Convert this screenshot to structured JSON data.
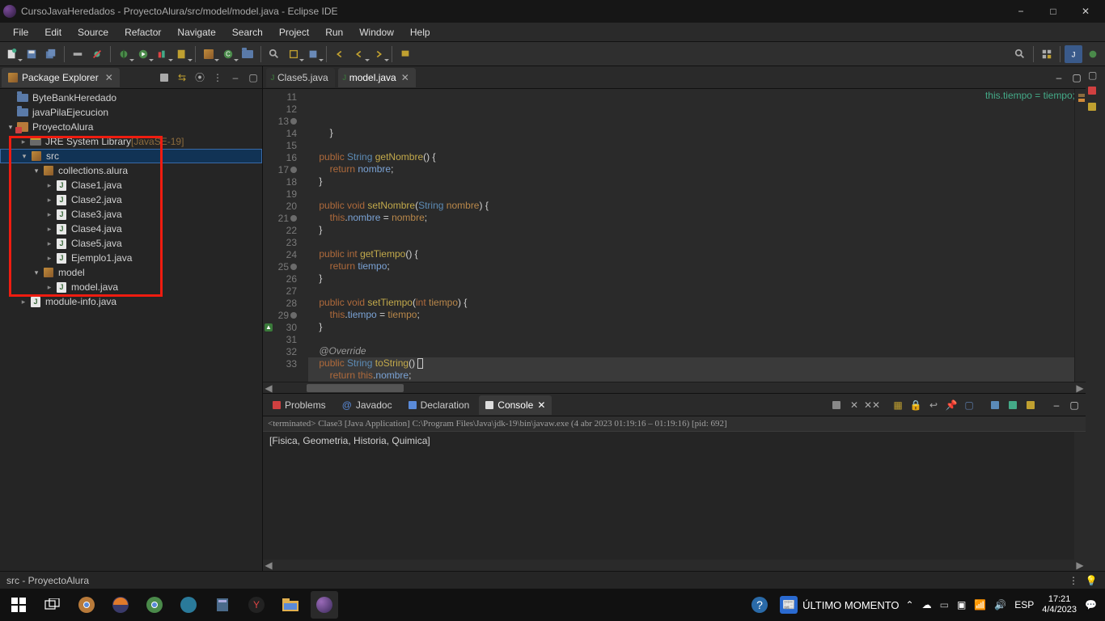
{
  "title": "CursoJavaHeredados - ProyectoAlura/src/model/model.java - Eclipse IDE",
  "menu": [
    "File",
    "Edit",
    "Source",
    "Refactor",
    "Navigate",
    "Search",
    "Project",
    "Run",
    "Window",
    "Help"
  ],
  "package_explorer": {
    "tab": "Package Explorer",
    "projects": [
      {
        "name": "ByteBankHeredado",
        "open": false,
        "icon": "folder"
      },
      {
        "name": "javaPilaEjecucion",
        "open": false,
        "icon": "folder"
      },
      {
        "name": "ProyectoAlura",
        "open": true,
        "icon": "project",
        "children": [
          {
            "name": "JRE System Library",
            "suffix": "[JavaSE-19]",
            "icon": "lib",
            "open": false
          },
          {
            "name": "src",
            "icon": "srcfolder",
            "open": true,
            "selected": true,
            "children": [
              {
                "name": "collections.alura",
                "icon": "pkg",
                "open": true,
                "children": [
                  {
                    "name": "Clase1.java",
                    "icon": "java"
                  },
                  {
                    "name": "Clase2.java",
                    "icon": "java"
                  },
                  {
                    "name": "Clase3.java",
                    "icon": "java"
                  },
                  {
                    "name": "Clase4.java",
                    "icon": "java"
                  },
                  {
                    "name": "Clase5.java",
                    "icon": "java"
                  },
                  {
                    "name": "Ejemplo1.java",
                    "icon": "java"
                  }
                ]
              },
              {
                "name": "model",
                "icon": "pkg",
                "open": true,
                "children": [
                  {
                    "name": "model.java",
                    "icon": "java"
                  }
                ]
              }
            ]
          },
          {
            "name": "module-info.java",
            "icon": "java",
            "open": false
          }
        ]
      }
    ]
  },
  "editor_tabs": [
    {
      "label": "Clase5.java",
      "active": false
    },
    {
      "label": "model.java",
      "active": true
    }
  ],
  "code_lines": [
    {
      "n": 11,
      "html": "        }"
    },
    {
      "n": 12,
      "html": ""
    },
    {
      "n": 13,
      "mark": "o",
      "html": "    <span class=\"kw\">public</span> <span class=\"type\">String</span> <span class=\"mname\">getNombre</span>() {"
    },
    {
      "n": 14,
      "html": "        <span class=\"kw\">return</span> <span class=\"fd\">nombre</span>;"
    },
    {
      "n": 15,
      "html": "    }"
    },
    {
      "n": 16,
      "html": ""
    },
    {
      "n": 17,
      "mark": "o",
      "html": "    <span class=\"kw\">public</span> <span class=\"kw\">void</span> <span class=\"mname\">setNombre</span>(<span class=\"type\">String</span> <span class=\"arg\">nombre</span>) {"
    },
    {
      "n": 18,
      "html": "        <span class=\"kw\">this</span>.<span class=\"fd\">nombre</span> = <span class=\"arg\">nombre</span>;"
    },
    {
      "n": 19,
      "html": "    }"
    },
    {
      "n": 20,
      "html": ""
    },
    {
      "n": 21,
      "mark": "o",
      "html": "    <span class=\"kw\">public</span> <span class=\"kw\">int</span> <span class=\"mname\">getTiempo</span>() {"
    },
    {
      "n": 22,
      "html": "        <span class=\"kw\">return</span> <span class=\"fd\">tiempo</span>;"
    },
    {
      "n": 23,
      "html": "    }"
    },
    {
      "n": 24,
      "html": ""
    },
    {
      "n": 25,
      "mark": "o",
      "html": "    <span class=\"kw\">public</span> <span class=\"kw\">void</span> <span class=\"mname\">setTiempo</span>(<span class=\"kw\">int</span> <span class=\"arg\">tiempo</span>) {"
    },
    {
      "n": 26,
      "html": "        <span class=\"kw\">this</span>.<span class=\"fd\">tiempo</span> = <span class=\"arg\">tiempo</span>;"
    },
    {
      "n": 27,
      "html": "    }"
    },
    {
      "n": 28,
      "html": ""
    },
    {
      "n": 29,
      "mark": "o",
      "html": "    <span class=\"anno\">@Override</span>"
    },
    {
      "n": 30,
      "ov": "▲",
      "hl": true,
      "html": "    <span class=\"kw\">public</span> <span class=\"type\">String</span> <span class=\"mname\">toString</span>() <span class=\"cur\"></span>"
    },
    {
      "n": 31,
      "hl": true,
      "html": "        <span class=\"kw\">return</span> <span class=\"kw\">this</span>.<span class=\"fd\">nombre</span>;"
    },
    {
      "n": 32,
      "hl": true,
      "html": "    }"
    },
    {
      "n": 33,
      "html": "}"
    }
  ],
  "bottom_tabs": [
    {
      "label": "Problems",
      "icon": "problems"
    },
    {
      "label": "Javadoc",
      "icon": "javadoc"
    },
    {
      "label": "Declaration",
      "icon": "decl"
    },
    {
      "label": "Console",
      "icon": "console",
      "active": true
    }
  ],
  "console": {
    "head": "<terminated> Clase3 [Java Application] C:\\Program Files\\Java\\jdk-19\\bin\\javaw.exe (4 abr 2023 01:19:16 – 01:19:16) [pid: 692]",
    "body": "[Fisica, Geometria, Historia, Quimica]"
  },
  "status": "src - ProyectoAlura",
  "taskbar": {
    "news": "ÚLTIMO MOMENTO",
    "lang": "ESP",
    "time": "17:21",
    "date": "4/4/2023"
  }
}
